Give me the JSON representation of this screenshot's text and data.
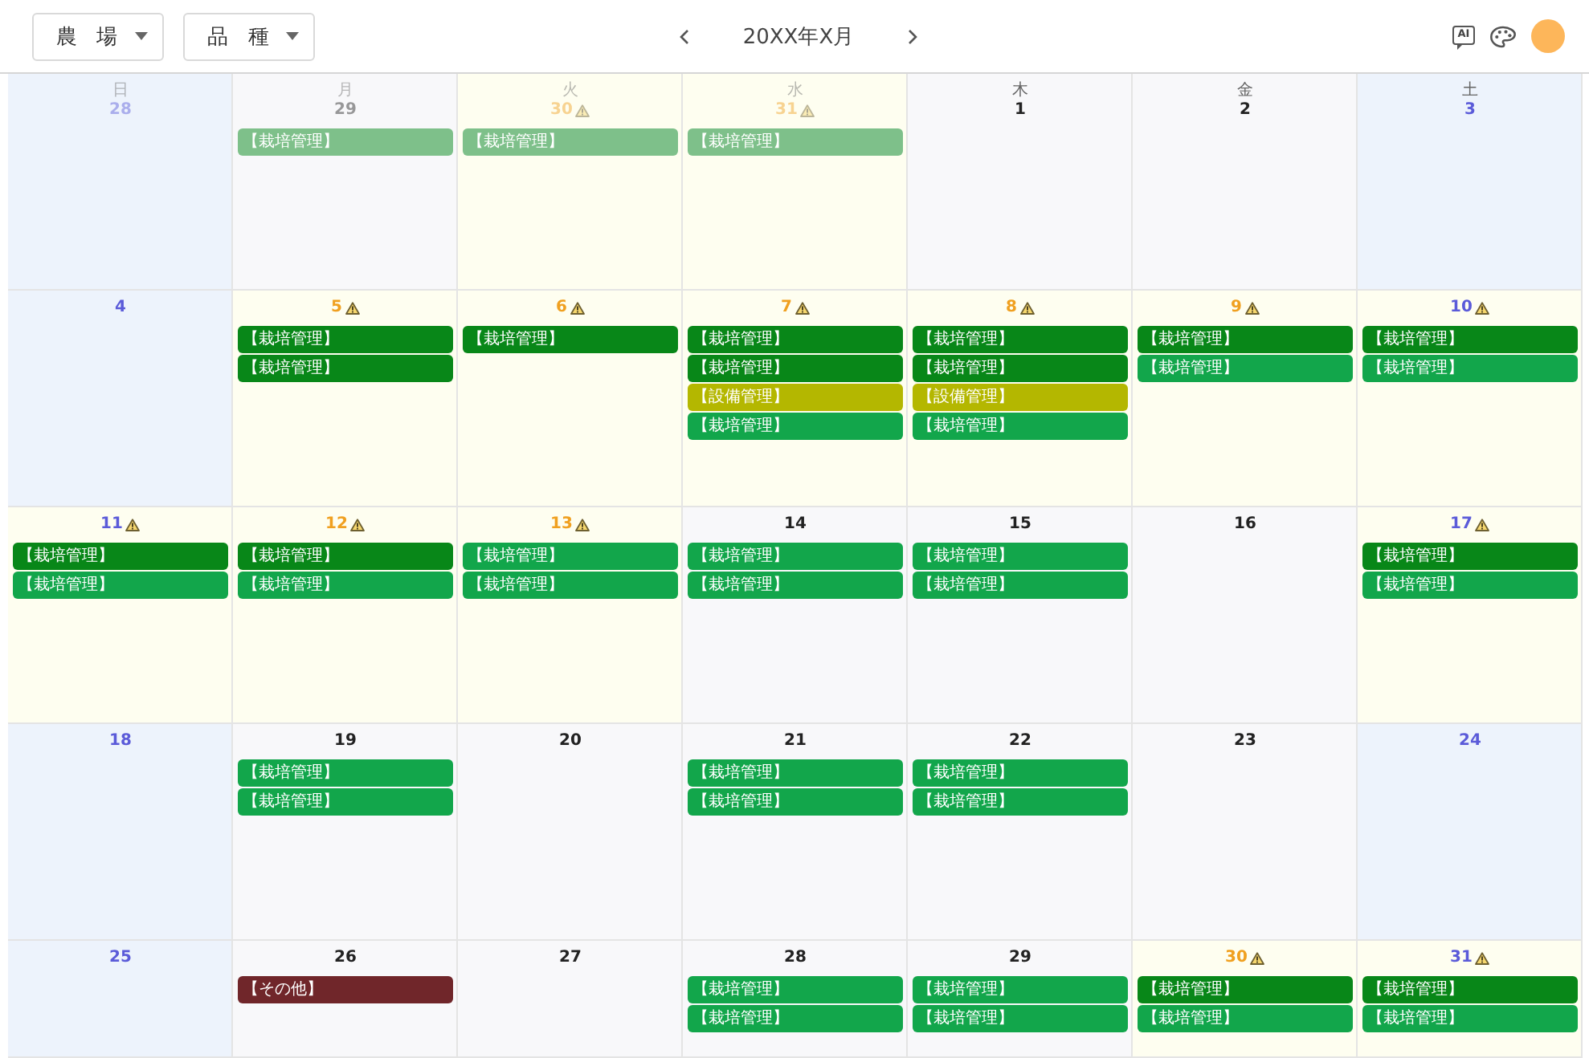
{
  "toolbar": {
    "filters": [
      {
        "label": "農 場"
      },
      {
        "label": "品 種"
      }
    ],
    "month": "20XX年X月",
    "assistant_label": "AI"
  },
  "calendar": {
    "weekdays": [
      "日",
      "月",
      "火",
      "水",
      "木",
      "金",
      "土"
    ],
    "weeks": [
      {
        "days": [
          {
            "date": "28",
            "other_month": true,
            "warning": false
          },
          {
            "date": "29",
            "other_month": true,
            "warning": false,
            "events": [
              {
                "label": "【栽培管理】",
                "color": "#7ec08a"
              }
            ]
          },
          {
            "date": "30",
            "other_month": true,
            "warning": true,
            "events": [
              {
                "label": "【栽培管理】",
                "color": "#7ec08a"
              }
            ]
          },
          {
            "date": "31",
            "other_month": true,
            "warning": true,
            "events": [
              {
                "label": "【栽培管理】",
                "color": "#7ec08a"
              }
            ]
          },
          {
            "date": "1",
            "other_month": false,
            "warning": false
          },
          {
            "date": "2",
            "other_month": false,
            "warning": false
          },
          {
            "date": "3",
            "other_month": false,
            "warning": false
          }
        ]
      },
      {
        "days": [
          {
            "date": "4",
            "other_month": false,
            "warning": false
          },
          {
            "date": "5",
            "other_month": false,
            "warning": true,
            "events": [
              {
                "label": "【栽培管理】",
                "color": "#088718"
              },
              {
                "label": "【栽培管理】",
                "color": "#088718"
              }
            ]
          },
          {
            "date": "6",
            "other_month": false,
            "warning": true,
            "events": [
              {
                "label": "【栽培管理】",
                "color": "#088718"
              }
            ]
          },
          {
            "date": "7",
            "other_month": false,
            "warning": true,
            "events": [
              {
                "label": "【栽培管理】",
                "color": "#088718"
              },
              {
                "label": "【栽培管理】",
                "color": "#088718"
              },
              {
                "label": "【設備管理】",
                "color": "#b4b700"
              },
              {
                "label": "【栽培管理】",
                "color": "#12a64b"
              }
            ]
          },
          {
            "date": "8",
            "other_month": false,
            "warning": true,
            "events": [
              {
                "label": "【栽培管理】",
                "color": "#088718"
              },
              {
                "label": "【栽培管理】",
                "color": "#088718"
              },
              {
                "label": "【設備管理】",
                "color": "#b4b700"
              },
              {
                "label": "【栽培管理】",
                "color": "#12a64b"
              }
            ]
          },
          {
            "date": "9",
            "other_month": false,
            "warning": true,
            "events": [
              {
                "label": "【栽培管理】",
                "color": "#088718"
              },
              {
                "label": "【栽培管理】",
                "color": "#12a64b"
              }
            ]
          },
          {
            "date": "10",
            "other_month": false,
            "warning": true,
            "events": [
              {
                "label": "【栽培管理】",
                "color": "#088718"
              },
              {
                "label": "【栽培管理】",
                "color": "#12a64b"
              }
            ]
          }
        ]
      },
      {
        "days": [
          {
            "date": "11",
            "other_month": false,
            "warning": true,
            "events": [
              {
                "label": "【栽培管理】",
                "color": "#088718"
              },
              {
                "label": "【栽培管理】",
                "color": "#12a64b"
              }
            ]
          },
          {
            "date": "12",
            "other_month": false,
            "warning": true,
            "events": [
              {
                "label": "【栽培管理】",
                "color": "#088718"
              },
              {
                "label": "【栽培管理】",
                "color": "#12a64b"
              }
            ]
          },
          {
            "date": "13",
            "other_month": false,
            "warning": true,
            "events": [
              {
                "label": "【栽培管理】",
                "color": "#12a64b"
              },
              {
                "label": "【栽培管理】",
                "color": "#12a64b"
              }
            ]
          },
          {
            "date": "14",
            "other_month": false,
            "warning": false,
            "events": [
              {
                "label": "【栽培管理】",
                "color": "#12a64b"
              },
              {
                "label": "【栽培管理】",
                "color": "#12a64b"
              }
            ]
          },
          {
            "date": "15",
            "other_month": false,
            "warning": false,
            "events": [
              {
                "label": "【栽培管理】",
                "color": "#12a64b"
              },
              {
                "label": "【栽培管理】",
                "color": "#12a64b"
              }
            ]
          },
          {
            "date": "16",
            "other_month": false,
            "warning": false
          },
          {
            "date": "17",
            "other_month": false,
            "warning": true,
            "events": [
              {
                "label": "【栽培管理】",
                "color": "#088718"
              },
              {
                "label": "【栽培管理】",
                "color": "#12a64b"
              }
            ]
          }
        ]
      },
      {
        "days": [
          {
            "date": "18",
            "other_month": false,
            "warning": false
          },
          {
            "date": "19",
            "other_month": false,
            "warning": false,
            "events": [
              {
                "label": "【栽培管理】",
                "color": "#12a64b"
              },
              {
                "label": "【栽培管理】",
                "color": "#12a64b"
              }
            ]
          },
          {
            "date": "20",
            "other_month": false,
            "warning": false
          },
          {
            "date": "21",
            "other_month": false,
            "warning": false,
            "events": [
              {
                "label": "【栽培管理】",
                "color": "#12a64b"
              },
              {
                "label": "【栽培管理】",
                "color": "#12a64b"
              }
            ]
          },
          {
            "date": "22",
            "other_month": false,
            "warning": false,
            "events": [
              {
                "label": "【栽培管理】",
                "color": "#12a64b"
              },
              {
                "label": "【栽培管理】",
                "color": "#12a64b"
              }
            ]
          },
          {
            "date": "23",
            "other_month": false,
            "warning": false
          },
          {
            "date": "24",
            "other_month": false,
            "warning": false
          }
        ]
      },
      {
        "days": [
          {
            "date": "25",
            "other_month": false,
            "warning": false
          },
          {
            "date": "26",
            "other_month": false,
            "warning": false,
            "events": [
              {
                "label": "【その他】",
                "color": "#70262a"
              }
            ]
          },
          {
            "date": "27",
            "other_month": false,
            "warning": false
          },
          {
            "date": "28",
            "other_month": false,
            "warning": false,
            "events": [
              {
                "label": "【栽培管理】",
                "color": "#12a64b"
              },
              {
                "label": "【栽培管理】",
                "color": "#12a64b"
              }
            ]
          },
          {
            "date": "29",
            "other_month": false,
            "warning": false,
            "events": [
              {
                "label": "【栽培管理】",
                "color": "#12a64b"
              },
              {
                "label": "【栽培管理】",
                "color": "#12a64b"
              }
            ]
          },
          {
            "date": "30",
            "other_month": false,
            "warning": true,
            "events": [
              {
                "label": "【栽培管理】",
                "color": "#088718"
              },
              {
                "label": "【栽培管理】",
                "color": "#12a64b"
              }
            ]
          },
          {
            "date": "31",
            "other_month": false,
            "warning": true,
            "events": [
              {
                "label": "【栽培管理】",
                "color": "#088718"
              },
              {
                "label": "【栽培管理】",
                "color": "#12a64b"
              }
            ]
          }
        ]
      }
    ]
  }
}
